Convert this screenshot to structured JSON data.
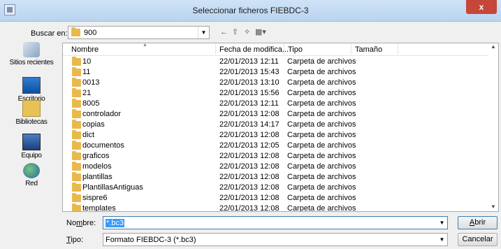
{
  "window": {
    "title": "Seleccionar ficheros FIEBDC-3",
    "close_label": "x"
  },
  "lookin": {
    "label": "Buscar en:",
    "value": "900"
  },
  "toolbar": {
    "back_glyph": "←",
    "up_glyph": "⇧",
    "newfolder_glyph": "✧",
    "views_glyph": "▦▾"
  },
  "places": [
    {
      "label": "Sitios recientes",
      "icon": "recent-places-icon"
    },
    {
      "label": "Escritorio",
      "icon": "desktop-icon"
    },
    {
      "label": "Bibliotecas",
      "icon": "libraries-icon"
    },
    {
      "label": "Equipo",
      "icon": "computer-icon"
    },
    {
      "label": "Red",
      "icon": "network-icon"
    }
  ],
  "columns": [
    "Nombre",
    "Fecha de modifica...",
    "Tipo",
    "Tamaño"
  ],
  "rows": [
    {
      "name": "10",
      "date": "22/01/2013 12:11",
      "type": "Carpeta de archivos"
    },
    {
      "name": "11",
      "date": "22/01/2013 15:43",
      "type": "Carpeta de archivos"
    },
    {
      "name": "0013",
      "date": "22/01/2013 13:10",
      "type": "Carpeta de archivos"
    },
    {
      "name": "21",
      "date": "22/01/2013 15:56",
      "type": "Carpeta de archivos"
    },
    {
      "name": "8005",
      "date": "22/01/2013 12:11",
      "type": "Carpeta de archivos"
    },
    {
      "name": "controlador",
      "date": "22/01/2013 12:08",
      "type": "Carpeta de archivos"
    },
    {
      "name": "copias",
      "date": "22/01/2013 14:17",
      "type": "Carpeta de archivos"
    },
    {
      "name": "dict",
      "date": "22/01/2013 12:08",
      "type": "Carpeta de archivos"
    },
    {
      "name": "documentos",
      "date": "22/01/2013 12:05",
      "type": "Carpeta de archivos"
    },
    {
      "name": "graficos",
      "date": "22/01/2013 12:08",
      "type": "Carpeta de archivos"
    },
    {
      "name": "modelos",
      "date": "22/01/2013 12:08",
      "type": "Carpeta de archivos"
    },
    {
      "name": "plantillas",
      "date": "22/01/2013 12:08",
      "type": "Carpeta de archivos"
    },
    {
      "name": "PlantillasAntiguas",
      "date": "22/01/2013 12:08",
      "type": "Carpeta de archivos"
    },
    {
      "name": "sispre6",
      "date": "22/01/2013 12:08",
      "type": "Carpeta de archivos"
    },
    {
      "name": "templates",
      "date": "22/01/2013 12:08",
      "type": "Carpeta de archivos"
    }
  ],
  "filename": {
    "label_pre": "No",
    "label_u": "m",
    "label_post": "bre:",
    "value": "*.bc3"
  },
  "filetype": {
    "label_u": "T",
    "label_post": "ipo:",
    "value": "Formato FIEBDC-3 (*.bc3)"
  },
  "buttons": {
    "open_u": "A",
    "open_rest": "brir",
    "cancel": "Cancelar"
  }
}
